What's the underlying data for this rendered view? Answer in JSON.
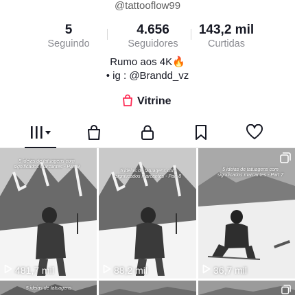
{
  "profile": {
    "handle": "@tattooflow99",
    "bio_line1": "Rumo aos 4K🔥",
    "bio_line2": "• ig : @Brandd_vz"
  },
  "stats": [
    {
      "value": "5",
      "label": "Seguindo"
    },
    {
      "value": "4.656",
      "label": "Seguidores"
    },
    {
      "value": "143,2 mil",
      "label": "Curtidas"
    }
  ],
  "vitrine": {
    "label": "Vitrine",
    "icon": "shopping-bag-icon",
    "color": "#fe2c55"
  },
  "tabs": [
    {
      "icon": "grid-icon",
      "active": true
    },
    {
      "icon": "shopping-bag-icon",
      "active": false
    },
    {
      "icon": "lock-icon",
      "active": false
    },
    {
      "icon": "bookmark-icon",
      "active": false
    },
    {
      "icon": "heart-icon",
      "active": false
    }
  ],
  "videos": [
    {
      "caption": "5 ideias de tatuagens com significados marcantes - Part 9",
      "views": "481,7 mil"
    },
    {
      "caption": "5 ideias de tatuagens com significados marcantes - Part 8",
      "views": "88,2 mil"
    },
    {
      "caption": "5 ideias de tatuagens com significados marcantes - Part 7",
      "views": "36,7 mil"
    },
    {
      "caption": "5 ideias de tatuagens",
      "views": ""
    },
    {
      "caption": "",
      "views": ""
    },
    {
      "caption": "",
      "views": ""
    }
  ]
}
